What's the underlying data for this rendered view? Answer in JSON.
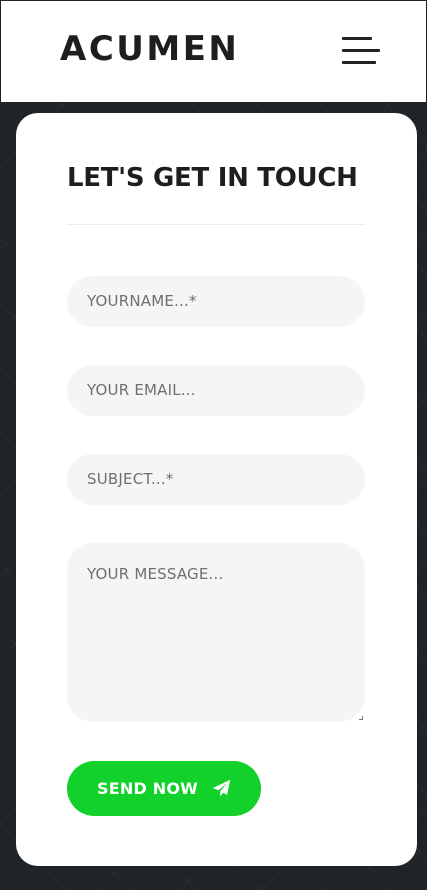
{
  "header": {
    "logo": "ACUMEN",
    "menu_icon": "hamburger-menu-icon"
  },
  "contact": {
    "title": "LET'S GET IN TOUCH",
    "name_placeholder": "YOURNAME...*",
    "email_placeholder": "YOUR EMAIL...",
    "subject_placeholder": "SUBJECT...*",
    "message_placeholder": "YOUR MESSAGE...",
    "send_label": "SEND NOW",
    "send_icon": "paper-plane-icon"
  },
  "colors": {
    "background": "#1f2428",
    "card": "#ffffff",
    "field": "#f5f5f5",
    "accent": "#12d12a",
    "text": "#1e1e1e"
  }
}
